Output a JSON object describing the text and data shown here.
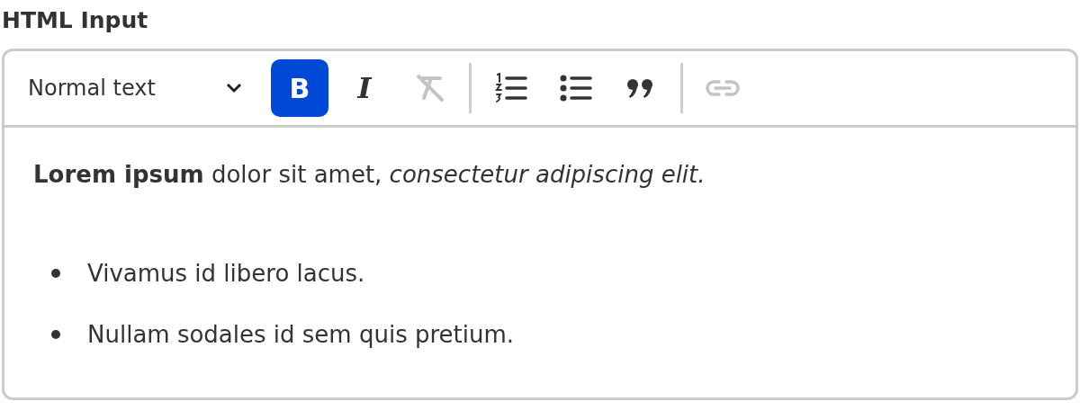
{
  "label": "HTML Input",
  "toolbar": {
    "style_select": {
      "value": "Normal text"
    },
    "groups": [
      [
        {
          "kind": "bold",
          "label": "B",
          "selected": true,
          "disabled": false
        },
        {
          "kind": "italic",
          "label": "I",
          "selected": false,
          "disabled": false
        },
        {
          "kind": "clear",
          "selected": false,
          "disabled": true
        }
      ],
      [
        {
          "kind": "ordered",
          "selected": false,
          "disabled": false
        },
        {
          "kind": "bullet",
          "selected": false,
          "disabled": false
        },
        {
          "kind": "quote",
          "selected": false,
          "disabled": false
        }
      ],
      [
        {
          "kind": "link",
          "selected": false,
          "disabled": true
        }
      ]
    ]
  },
  "content": {
    "paragraph": "**Lorem ipsum** dolor sit amet, *consectetur adipiscing elit.*",
    "bullets": [
      "Vivamus id libero lacus.",
      "Nullam sodales id sem quis pretium."
    ]
  }
}
